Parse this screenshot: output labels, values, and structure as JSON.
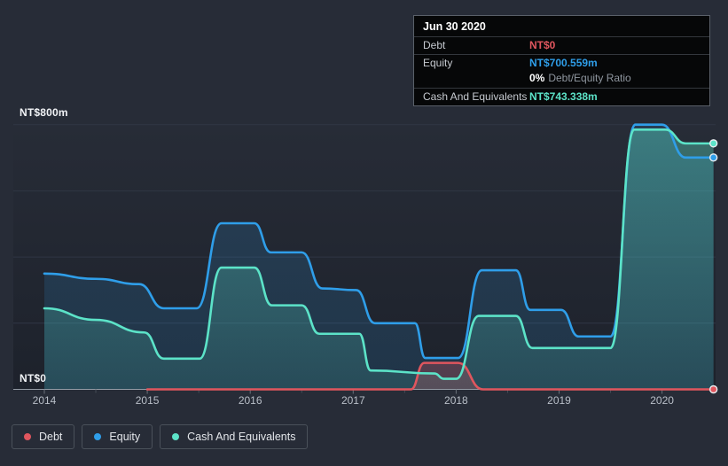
{
  "tooltip": {
    "date": "Jun 30 2020",
    "debt_label": "Debt",
    "debt_value": "NT$0",
    "equity_label": "Equity",
    "equity_value": "NT$700.559m",
    "ratio_value": "0%",
    "ratio_label": "Debt/Equity Ratio",
    "cash_label": "Cash And Equivalents",
    "cash_value": "NT$743.338m"
  },
  "legend": {
    "items": [
      {
        "label": "Debt"
      },
      {
        "label": "Equity"
      },
      {
        "label": "Cash And Equivalents"
      }
    ]
  },
  "chart_data": {
    "type": "area",
    "x_axis": {
      "ticks": [
        "2014",
        "2015",
        "2016",
        "2017",
        "2018",
        "2019",
        "2020"
      ],
      "start_year": 2014,
      "end_year": 2020.5
    },
    "y_axis": {
      "top_label": "NT$800m",
      "bottom_label": "NT$0",
      "min": 0,
      "max": 800,
      "unit": "NT$ millions",
      "gridlines": [
        800,
        600,
        400,
        200,
        0
      ]
    },
    "series": [
      {
        "name": "Debt",
        "color": "#e0565e",
        "points": [
          [
            2015.0,
            0
          ],
          [
            2017.56,
            0
          ],
          [
            2017.69,
            80
          ],
          [
            2018.02,
            80
          ],
          [
            2018.26,
            0
          ],
          [
            2020.5,
            0
          ]
        ]
      },
      {
        "name": "Equity",
        "color": "#2f9ee9",
        "points": [
          [
            2014.0,
            350
          ],
          [
            2014.5,
            334
          ],
          [
            2014.92,
            318
          ],
          [
            2015.16,
            245
          ],
          [
            2015.48,
            245
          ],
          [
            2015.72,
            502
          ],
          [
            2016.04,
            502
          ],
          [
            2016.2,
            414
          ],
          [
            2016.5,
            414
          ],
          [
            2016.7,
            305
          ],
          [
            2017.03,
            300
          ],
          [
            2017.21,
            200
          ],
          [
            2017.6,
            200
          ],
          [
            2017.7,
            95
          ],
          [
            2018.02,
            95
          ],
          [
            2018.25,
            360
          ],
          [
            2018.58,
            360
          ],
          [
            2018.72,
            240
          ],
          [
            2019.02,
            240
          ],
          [
            2019.19,
            160
          ],
          [
            2019.5,
            160
          ],
          [
            2019.74,
            800
          ],
          [
            2020.0,
            800
          ],
          [
            2020.23,
            700.559
          ],
          [
            2020.5,
            700.559
          ]
        ]
      },
      {
        "name": "Cash And Equivalents",
        "color": "#5ce3c8",
        "points": [
          [
            2014.0,
            245
          ],
          [
            2014.5,
            210
          ],
          [
            2014.97,
            172
          ],
          [
            2015.16,
            93
          ],
          [
            2015.51,
            93
          ],
          [
            2015.72,
            368
          ],
          [
            2016.04,
            368
          ],
          [
            2016.21,
            254
          ],
          [
            2016.5,
            254
          ],
          [
            2016.67,
            168
          ],
          [
            2017.06,
            168
          ],
          [
            2017.17,
            57
          ],
          [
            2017.79,
            48
          ],
          [
            2017.88,
            32
          ],
          [
            2018.0,
            32
          ],
          [
            2018.22,
            222
          ],
          [
            2018.58,
            222
          ],
          [
            2018.74,
            125
          ],
          [
            2019.5,
            125
          ],
          [
            2019.73,
            785
          ],
          [
            2020.03,
            785
          ],
          [
            2020.23,
            743.338
          ],
          [
            2020.5,
            743.338
          ]
        ]
      }
    ]
  }
}
